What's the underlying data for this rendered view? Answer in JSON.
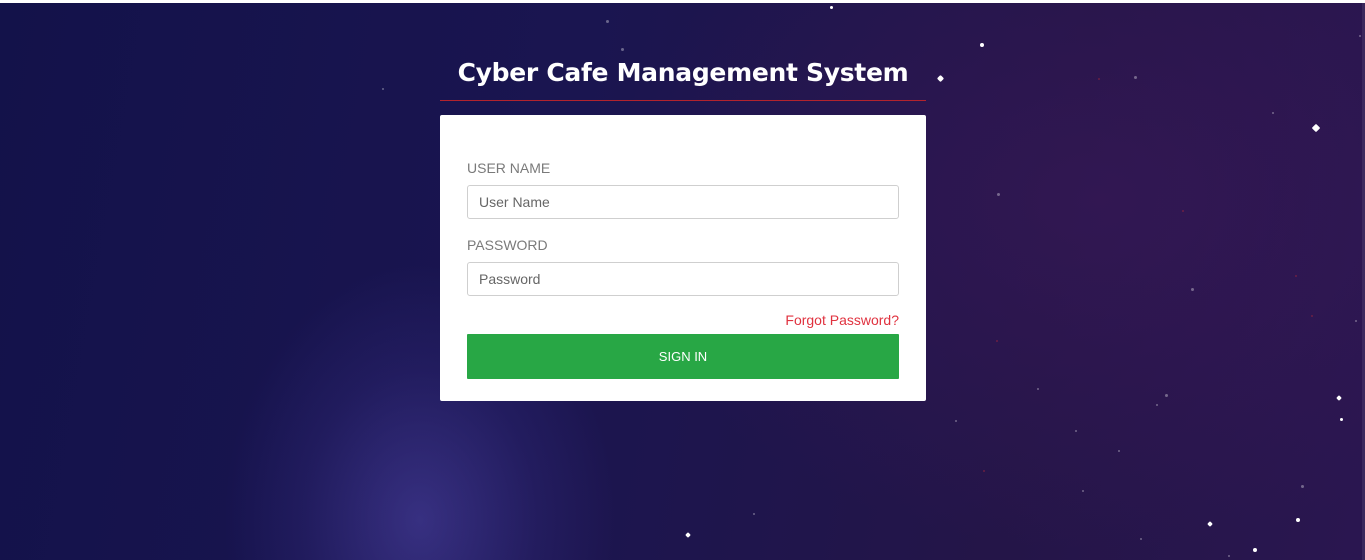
{
  "app": {
    "title": "Cyber Cafe Management System"
  },
  "login": {
    "username_label": "USER NAME",
    "username_placeholder": "User Name",
    "username_value": "",
    "password_label": "PASSWORD",
    "password_placeholder": "Password",
    "password_value": "",
    "forgot_label": "Forgot Password?",
    "signin_label": "SIGN IN"
  },
  "colors": {
    "background": "#1a1550",
    "title_underline": "#b3232d",
    "forgot_link": "#e0323f",
    "signin_button": "#28a745",
    "card": "#ffffff"
  }
}
